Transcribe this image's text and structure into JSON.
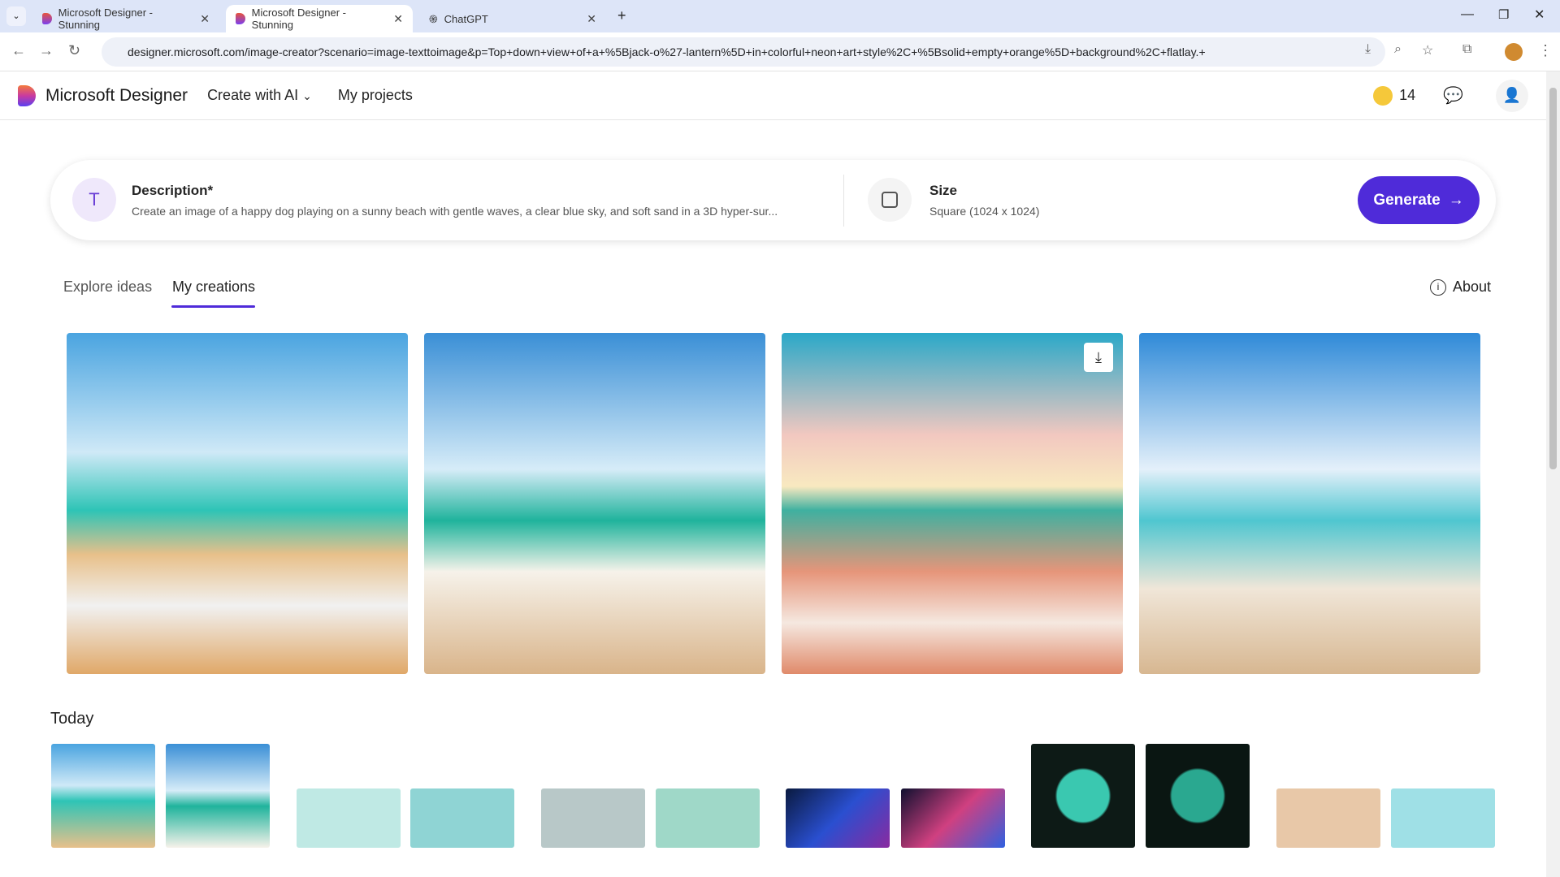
{
  "browser": {
    "tabs": [
      {
        "title": "Microsoft Designer - Stunning"
      },
      {
        "title": "Microsoft Designer - Stunning"
      },
      {
        "title": "ChatGPT"
      }
    ],
    "url": "designer.microsoft.com/image-creator?scenario=image-texttoimage&p=Top+down+view+of+a+%5Bjack-o%27-lantern%5D+in+colorful+neon+art+style%2C+%5Bsolid+empty+orange%5D+background%2C+flatlay.+"
  },
  "header": {
    "brand": "Microsoft Designer",
    "create_with_ai": "Create with AI",
    "my_projects": "My projects",
    "credits": "14"
  },
  "prompt": {
    "description_label": "Description*",
    "description_value": "Create an image of a happy dog playing on a sunny beach with gentle waves, a clear blue sky, and soft sand in a 3D hyper-sur...",
    "size_label": "Size",
    "size_value": "Square (1024 x 1024)",
    "generate": "Generate"
  },
  "tabs": {
    "explore": "Explore ideas",
    "creations": "My creations",
    "active": "My creations",
    "about": "About"
  },
  "section_today": "Today",
  "colors": {
    "accent": "#4f2bd9",
    "tab_underline": "#4f2bd9"
  }
}
